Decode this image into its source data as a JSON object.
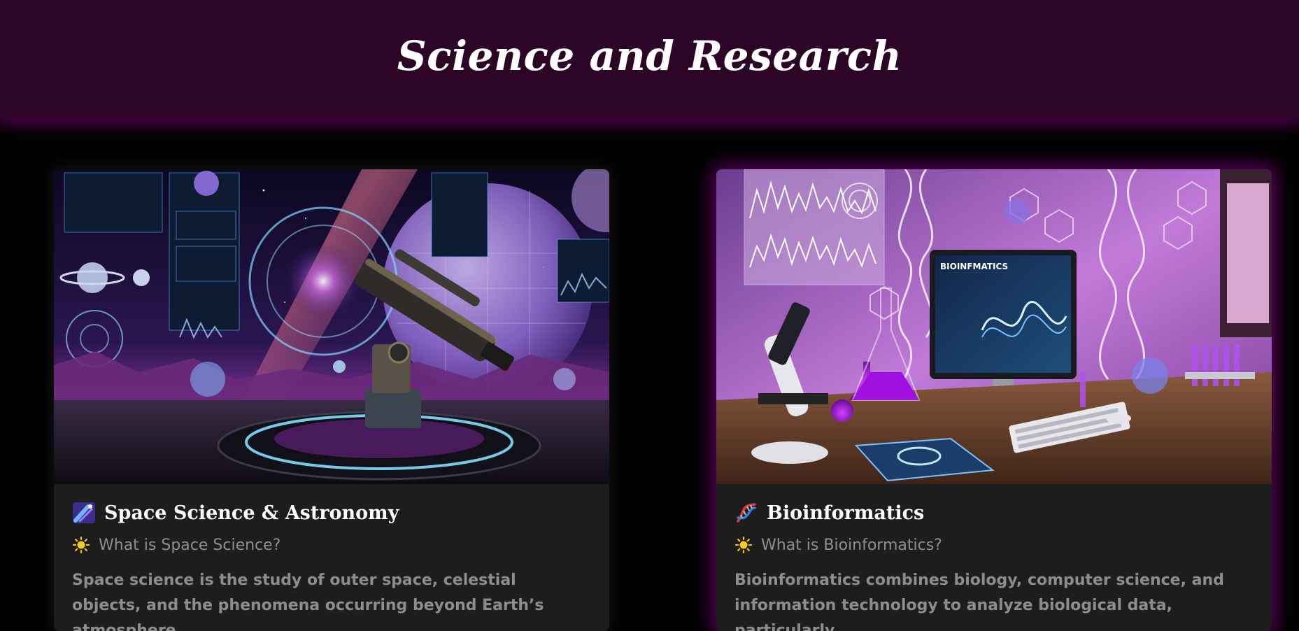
{
  "page": {
    "title": "Science and Research"
  },
  "cards": [
    {
      "title": "Space Science & Astronomy",
      "title_icon": "comet-icon",
      "subtitle": "What is Space Science?",
      "subtitle_icon": "sun-icon",
      "image_label": "space-science-illustration",
      "description": "Space science is the study of outer space, celestial objects, and the phenomena occurring beyond Earth’s atmosphere."
    },
    {
      "title": "Bioinformatics",
      "title_icon": "dna-icon",
      "subtitle": "What is Bioinformatics?",
      "subtitle_icon": "sun-icon",
      "image_label": "bioinformatics-illustration",
      "screen_text": "BIOINFMATICS",
      "description": "Bioinformatics combines biology, computer science, and information technology to analyze biological data, particularly"
    }
  ],
  "colors": {
    "header_bg": "#2c0425",
    "accent_glow": "#aa00aa",
    "card_bg": "#1d1d1d",
    "muted_text": "#8d8d8d"
  }
}
